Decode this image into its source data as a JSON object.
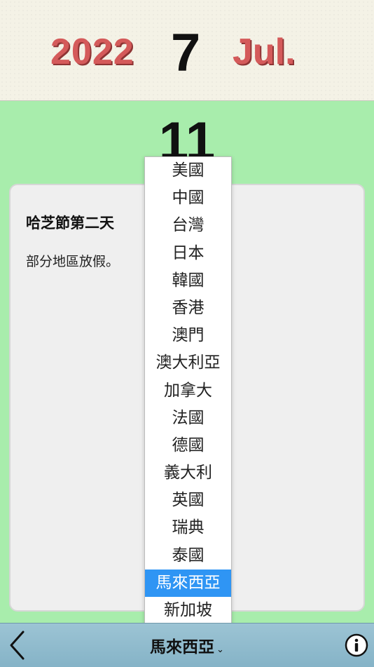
{
  "header": {
    "year": "2022",
    "month_number": "7",
    "month_name": "Jul."
  },
  "main": {
    "day": "11",
    "event": {
      "title": "哈芝節第二天",
      "description": "部分地區放假。"
    }
  },
  "dropdown": {
    "options": [
      "美國",
      "中國",
      "台灣",
      "日本",
      "韓國",
      "香港",
      "澳門",
      "澳大利亞",
      "加拿大",
      "法國",
      "德國",
      "義大利",
      "英國",
      "瑞典",
      "泰國",
      "馬來西亞",
      "新加坡"
    ],
    "selected": "馬來西亞"
  },
  "footer": {
    "country": "馬來西亞",
    "chevron": "⌄"
  },
  "colors": {
    "accent_red": "#d45a5a",
    "background_green": "#a8edac",
    "selection_blue": "#2f95f4",
    "footer_blue": "#85b3c7"
  }
}
